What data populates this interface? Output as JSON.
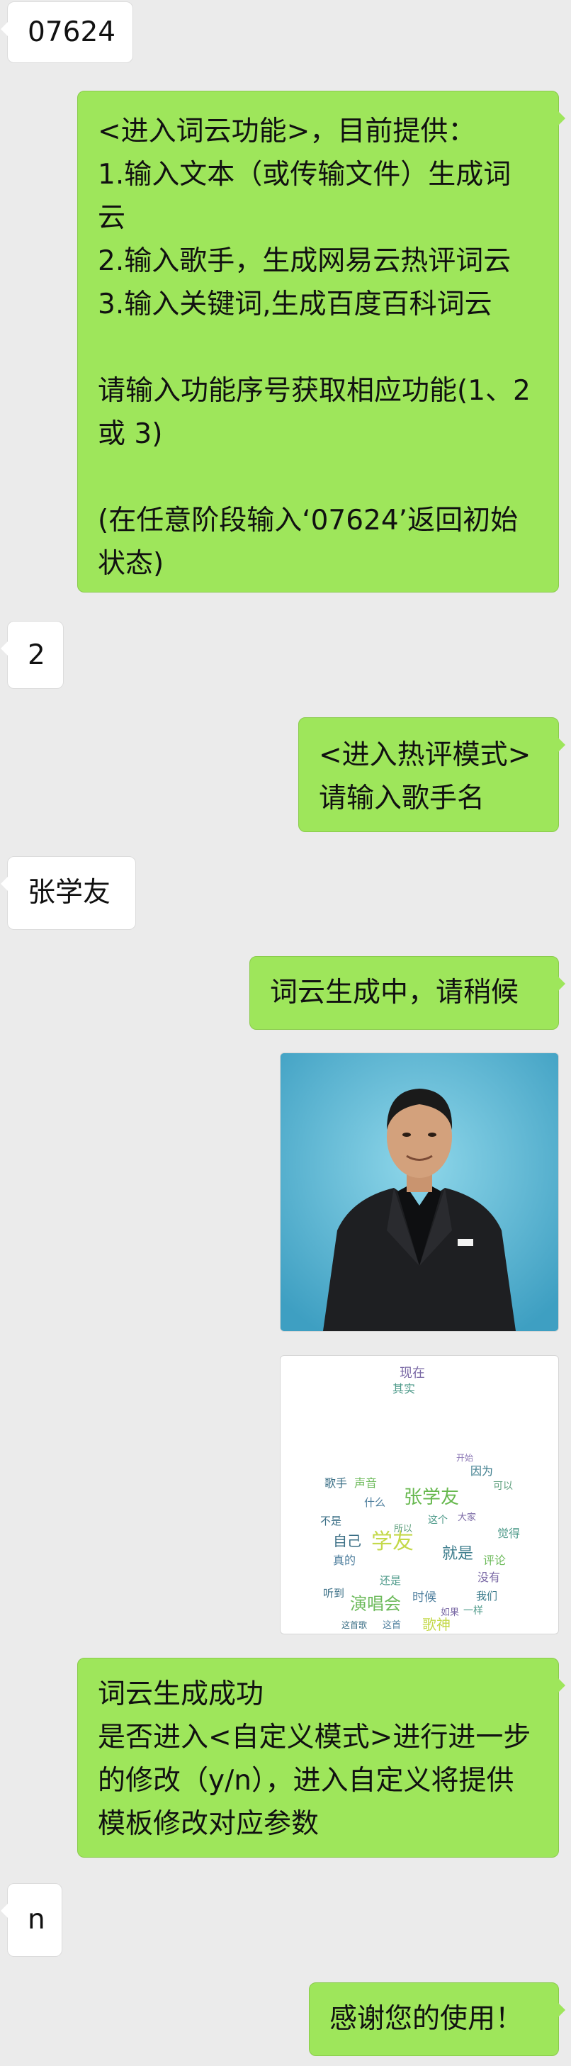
{
  "messages": [
    {
      "side": "in",
      "text": "07624"
    },
    {
      "side": "out",
      "text": "<进入词云功能>，目前提供：\n1.输入文本（或传输文件）生成词云\n2.输入歌手，生成网易云热评词云\n3.输入关键词,生成百度百科词云\n\n请输入功能序号获取相应功能(1、2 或 3)\n\n(在任意阶段输入‘07624’返回初始状态)"
    },
    {
      "side": "in",
      "text": "2"
    },
    {
      "side": "out",
      "text": "<进入热评模式>\n请输入歌手名"
    },
    {
      "side": "in",
      "text": "张学友"
    },
    {
      "side": "out",
      "text": "词云生成中，请稍候"
    },
    {
      "side": "out",
      "image": "singer-photo"
    },
    {
      "side": "out",
      "image": "word-cloud"
    },
    {
      "side": "out",
      "text": "词云生成成功\n是否进入<自定义模式>进行进一步的修改（y/n），进入自定义将提供模板修改对应参数"
    },
    {
      "side": "in",
      "text": "n"
    },
    {
      "side": "out",
      "text": "感谢您的使用！"
    }
  ],
  "wordcloud_words": [
    "现在",
    "其实",
    "歌手",
    "声音",
    "因为",
    "开始",
    "可以",
    "什么",
    "张学友",
    "不是",
    "这个",
    "大家",
    "自己",
    "学友",
    "觉得",
    "真的",
    "就是",
    "评论",
    "没有",
    "听到",
    "还是",
    "时候",
    "我们",
    "演唱会",
    "如果",
    "一样",
    "这首歌",
    "歌神",
    "这首",
    "所以"
  ],
  "colors": {
    "background": "#ebebeb",
    "incoming_bubble": "#ffffff",
    "outgoing_bubble": "#9ee65b",
    "text": "#111111"
  }
}
